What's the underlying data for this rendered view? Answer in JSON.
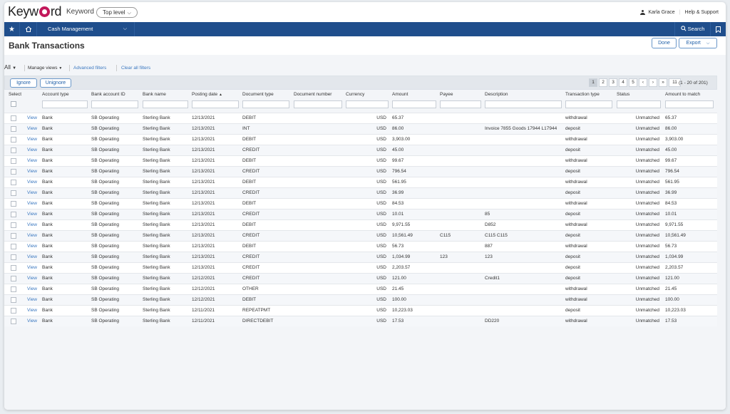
{
  "app": {
    "logo_prefix": "Keyw",
    "logo_suffix": "rd",
    "company": "Keyword",
    "level": "Top level"
  },
  "user": {
    "name": "Karla Grace",
    "help": "Help & Support"
  },
  "nav": {
    "menu": "Cash Management",
    "search": "Search"
  },
  "page": {
    "title": "Bank Transactions",
    "done": "Done",
    "export": "Export"
  },
  "filters": {
    "view": "All",
    "manage": "Manage views",
    "advanced": "Advanced filters",
    "clear": "Clear all filters"
  },
  "toolbar": {
    "ignore": "Ignore",
    "unignore": "Unignore",
    "pages": [
      "1",
      "2",
      "3",
      "4",
      "5",
      "‹",
      "›",
      "»",
      "11"
    ],
    "range": "(1 - 20 of 201)"
  },
  "columns": [
    "Select",
    "Account type",
    "Bank account ID",
    "Bank name",
    "Posting date",
    "Document type",
    "Document number",
    "Currency",
    "Amount",
    "Payee",
    "Description",
    "Transaction type",
    "Status",
    "Amount to match"
  ],
  "sort_indicator": "▲",
  "rows": [
    {
      "link": "View",
      "acct": "Bank",
      "id": "SB Operating",
      "bank": "Sterling Bank",
      "date": "12/13/2021",
      "doc": "DEBIT",
      "num": "",
      "cur": "USD",
      "amt": "65.37",
      "payee": "",
      "desc": "",
      "type": "withdrawal",
      "status": "Unmatched",
      "match": "65.37"
    },
    {
      "link": "View",
      "acct": "Bank",
      "id": "SB Operating",
      "bank": "Sterling Bank",
      "date": "12/13/2021",
      "doc": "INT",
      "num": "",
      "cur": "USD",
      "amt": "86.00",
      "payee": "",
      "desc": "Invoice 7855 Goods 17944 L17944",
      "type": "deposit",
      "status": "Unmatched",
      "match": "86.00"
    },
    {
      "link": "View",
      "acct": "Bank",
      "id": "SB Operating",
      "bank": "Sterling Bank",
      "date": "12/13/2021",
      "doc": "DEBIT",
      "num": "",
      "cur": "USD",
      "amt": "3,903.00",
      "payee": "",
      "desc": "",
      "type": "withdrawal",
      "status": "Unmatched",
      "match": "3,903.00"
    },
    {
      "link": "View",
      "acct": "Bank",
      "id": "SB Operating",
      "bank": "Sterling Bank",
      "date": "12/13/2021",
      "doc": "CREDIT",
      "num": "",
      "cur": "USD",
      "amt": "45.00",
      "payee": "",
      "desc": "",
      "type": "deposit",
      "status": "Unmatched",
      "match": "45.00"
    },
    {
      "link": "View",
      "acct": "Bank",
      "id": "SB Operating",
      "bank": "Sterling Bank",
      "date": "12/13/2021",
      "doc": "DEBIT",
      "num": "",
      "cur": "USD",
      "amt": "99.67",
      "payee": "",
      "desc": "",
      "type": "withdrawal",
      "status": "Unmatched",
      "match": "99.67"
    },
    {
      "link": "View",
      "acct": "Bank",
      "id": "SB Operating",
      "bank": "Sterling Bank",
      "date": "12/13/2021",
      "doc": "CREDIT",
      "num": "",
      "cur": "USD",
      "amt": "796.54",
      "payee": "",
      "desc": "",
      "type": "deposit",
      "status": "Unmatched",
      "match": "796.54"
    },
    {
      "link": "View",
      "acct": "Bank",
      "id": "SB Operating",
      "bank": "Sterling Bank",
      "date": "12/13/2021",
      "doc": "DEBIT",
      "num": "",
      "cur": "USD",
      "amt": "561.95",
      "payee": "",
      "desc": "",
      "type": "withdrawal",
      "status": "Unmatched",
      "match": "561.95"
    },
    {
      "link": "View",
      "acct": "Bank",
      "id": "SB Operating",
      "bank": "Sterling Bank",
      "date": "12/13/2021",
      "doc": "CREDIT",
      "num": "",
      "cur": "USD",
      "amt": "36.99",
      "payee": "",
      "desc": "",
      "type": "deposit",
      "status": "Unmatched",
      "match": "36.99"
    },
    {
      "link": "View",
      "acct": "Bank",
      "id": "SB Operating",
      "bank": "Sterling Bank",
      "date": "12/13/2021",
      "doc": "DEBIT",
      "num": "",
      "cur": "USD",
      "amt": "84.53",
      "payee": "",
      "desc": "",
      "type": "withdrawal",
      "status": "Unmatched",
      "match": "84.53"
    },
    {
      "link": "View",
      "acct": "Bank",
      "id": "SB Operating",
      "bank": "Sterling Bank",
      "date": "12/13/2021",
      "doc": "CREDIT",
      "num": "",
      "cur": "USD",
      "amt": "10.01",
      "payee": "",
      "desc": "85",
      "type": "deposit",
      "status": "Unmatched",
      "match": "10.01"
    },
    {
      "link": "View",
      "acct": "Bank",
      "id": "SB Operating",
      "bank": "Sterling Bank",
      "date": "12/13/2021",
      "doc": "DEBIT",
      "num": "",
      "cur": "USD",
      "amt": "9,971.55",
      "payee": "",
      "desc": "D852",
      "type": "withdrawal",
      "status": "Unmatched",
      "match": "9,971.55"
    },
    {
      "link": "View",
      "acct": "Bank",
      "id": "SB Operating",
      "bank": "Sterling Bank",
      "date": "12/13/2021",
      "doc": "CREDIT",
      "num": "",
      "cur": "USD",
      "amt": "10,561.49",
      "payee": "C115",
      "desc": "C115 C115",
      "type": "deposit",
      "status": "Unmatched",
      "match": "10,561.49"
    },
    {
      "link": "View",
      "acct": "Bank",
      "id": "SB Operating",
      "bank": "Sterling Bank",
      "date": "12/13/2021",
      "doc": "DEBIT",
      "num": "",
      "cur": "USD",
      "amt": "56.73",
      "payee": "",
      "desc": "887",
      "type": "withdrawal",
      "status": "Unmatched",
      "match": "56.73"
    },
    {
      "link": "View",
      "acct": "Bank",
      "id": "SB Operating",
      "bank": "Sterling Bank",
      "date": "12/13/2021",
      "doc": "CREDIT",
      "num": "",
      "cur": "USD",
      "amt": "1,034.99",
      "payee": "123",
      "desc": "123",
      "type": "deposit",
      "status": "Unmatched",
      "match": "1,034.99"
    },
    {
      "link": "View",
      "acct": "Bank",
      "id": "SB Operating",
      "bank": "Sterling Bank",
      "date": "12/13/2021",
      "doc": "CREDIT",
      "num": "",
      "cur": "USD",
      "amt": "2,203.57",
      "payee": "",
      "desc": "",
      "type": "deposit",
      "status": "Unmatched",
      "match": "2,203.57"
    },
    {
      "link": "View",
      "acct": "Bank",
      "id": "SB Operating",
      "bank": "Sterling Bank",
      "date": "12/12/2021",
      "doc": "CREDIT",
      "num": "",
      "cur": "USD",
      "amt": "121.00",
      "payee": "",
      "desc": "Credit1",
      "type": "deposit",
      "status": "Unmatched",
      "match": "121.00"
    },
    {
      "link": "View",
      "acct": "Bank",
      "id": "SB Operating",
      "bank": "Sterling Bank",
      "date": "12/12/2021",
      "doc": "OTHER",
      "num": "",
      "cur": "USD",
      "amt": "21.45",
      "payee": "",
      "desc": "",
      "type": "withdrawal",
      "status": "Unmatched",
      "match": "21.45"
    },
    {
      "link": "View",
      "acct": "Bank",
      "id": "SB Operating",
      "bank": "Sterling Bank",
      "date": "12/12/2021",
      "doc": "DEBIT",
      "num": "",
      "cur": "USD",
      "amt": "100.00",
      "payee": "",
      "desc": "",
      "type": "withdrawal",
      "status": "Unmatched",
      "match": "100.00"
    },
    {
      "link": "View",
      "acct": "Bank",
      "id": "SB Operating",
      "bank": "Sterling Bank",
      "date": "12/11/2021",
      "doc": "REPEATPMT",
      "num": "",
      "cur": "USD",
      "amt": "10,223.03",
      "payee": "",
      "desc": "",
      "type": "deposit",
      "status": "Unmatched",
      "match": "10,223.03"
    },
    {
      "link": "View",
      "acct": "Bank",
      "id": "SB Operating",
      "bank": "Sterling Bank",
      "date": "12/11/2021",
      "doc": "DIRECTDEBIT",
      "num": "",
      "cur": "USD",
      "amt": "17.53",
      "payee": "",
      "desc": "DD220",
      "type": "withdrawal",
      "status": "Unmatched",
      "match": "17.53"
    }
  ]
}
